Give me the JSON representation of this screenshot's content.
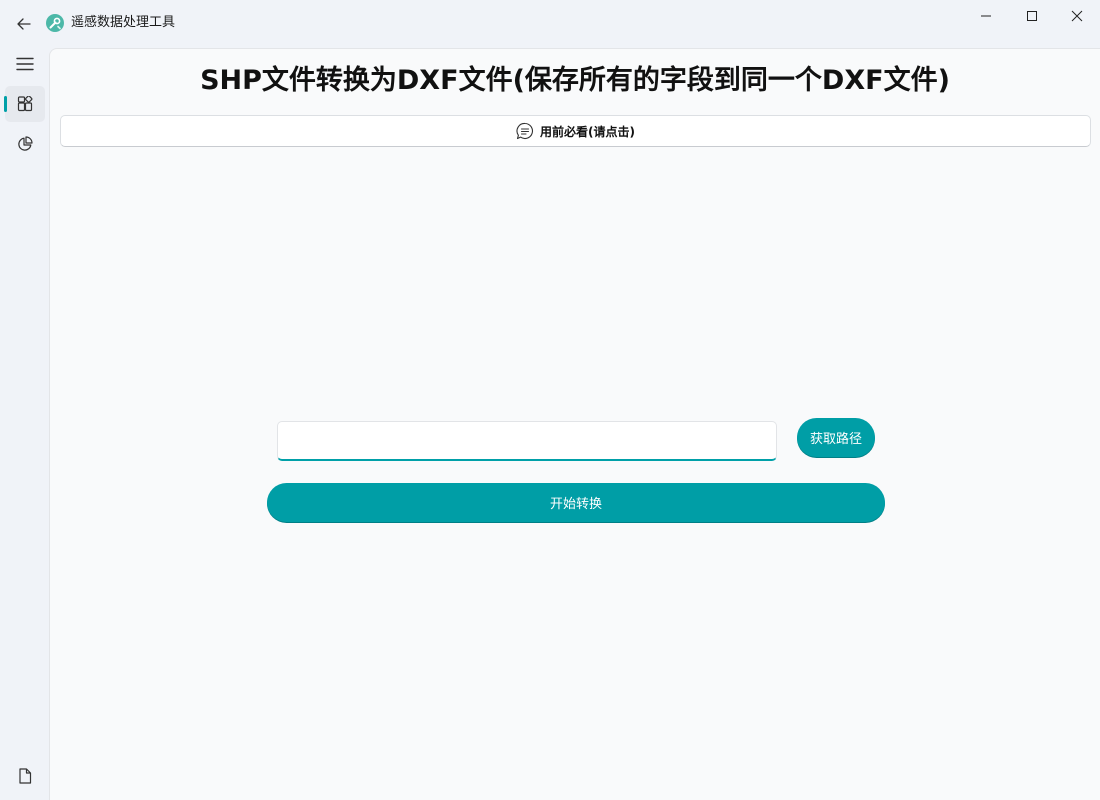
{
  "window": {
    "title": "遥感数据处理工具"
  },
  "titlebar": {
    "back_icon": "arrow-left-icon",
    "logo_icon": "app-logo-icon",
    "minimize_icon": "minimize-icon",
    "maximize_icon": "maximize-icon",
    "close_icon": "close-icon"
  },
  "nav": {
    "items": [
      {
        "icon": "hamburger-menu-icon",
        "selected": false
      },
      {
        "icon": "apps-grid-icon",
        "selected": true
      },
      {
        "icon": "pie-chart-icon",
        "selected": false
      }
    ],
    "footer_icon": "document-icon"
  },
  "main": {
    "title": "SHP文件转换为DXF文件(保存所有的字段到同一个DXF文件)",
    "readme_button": {
      "label": "用前必看(请点击)",
      "icon": "chat-message-icon"
    },
    "path_input": {
      "value": "",
      "placeholder": ""
    },
    "get_path_button": {
      "label": "获取路径"
    },
    "start_button": {
      "label": "开始转换"
    }
  },
  "colors": {
    "accent": "#009ea6",
    "background": "#f0f3f8",
    "panel": "#f9fafb"
  }
}
